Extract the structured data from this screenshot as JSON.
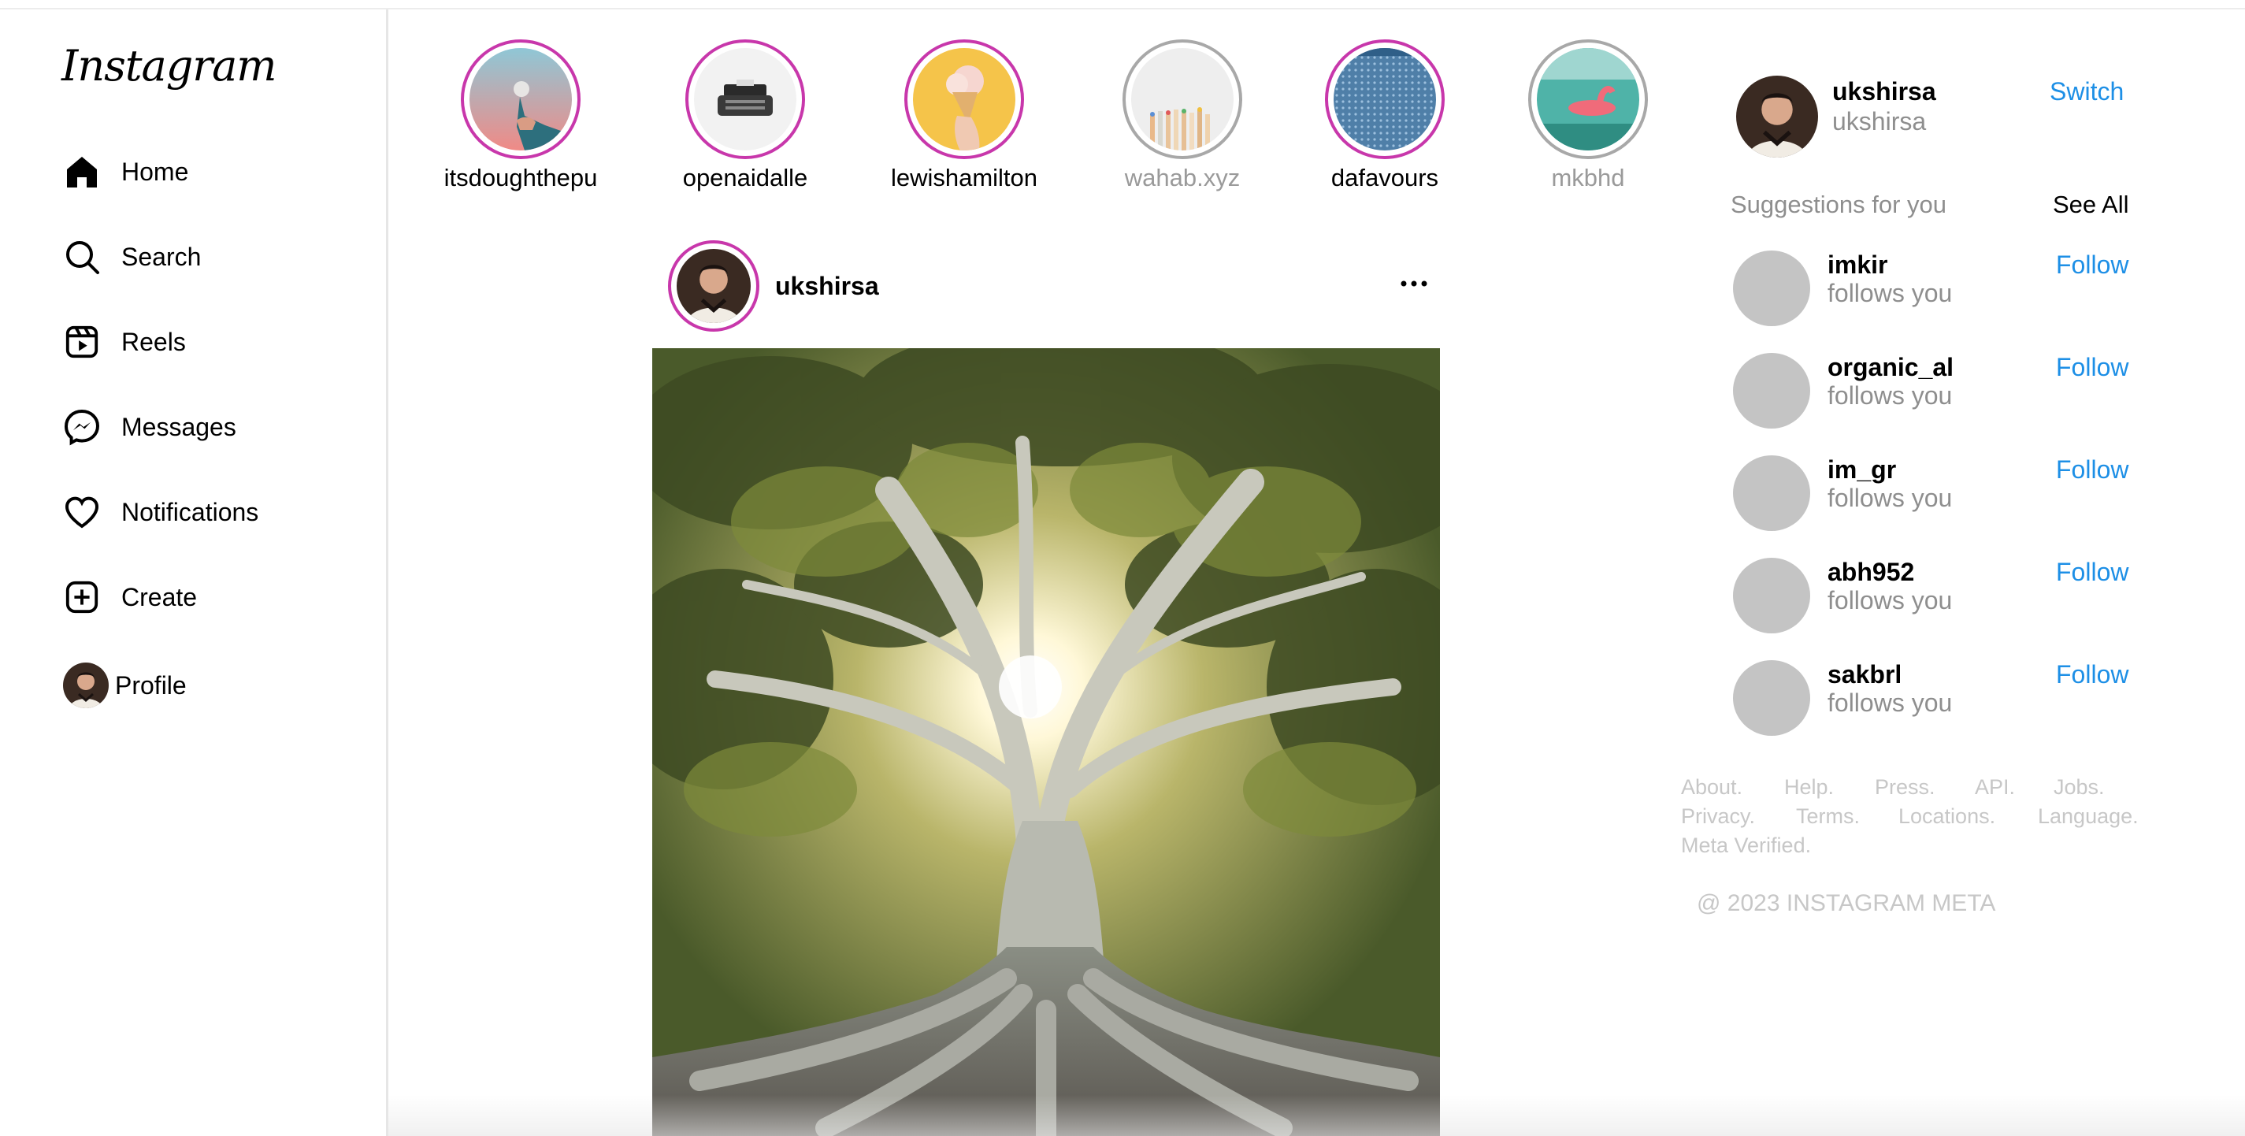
{
  "app": {
    "logo_text": "Instagram"
  },
  "sidebar": {
    "items": [
      {
        "label": "Home",
        "icon": "home-icon"
      },
      {
        "label": "Search",
        "icon": "search-icon"
      },
      {
        "label": "Reels",
        "icon": "reels-icon"
      },
      {
        "label": "Messages",
        "icon": "messenger-icon"
      },
      {
        "label": "Notifications",
        "icon": "heart-icon"
      },
      {
        "label": "Create",
        "icon": "plus-square-icon"
      },
      {
        "label": "Profile",
        "icon": "avatar"
      }
    ]
  },
  "stories": [
    {
      "username": "itsdoughthepu",
      "seen": false
    },
    {
      "username": "openaidalle",
      "seen": false
    },
    {
      "username": "lewishamilton",
      "seen": false
    },
    {
      "username": "wahab.xyz",
      "seen": true
    },
    {
      "username": "dafavours",
      "seen": false
    },
    {
      "username": "mkbhd",
      "seen": true
    }
  ],
  "post": {
    "username": "ukshirsa",
    "more_icon": "more-horizontal-icon"
  },
  "current_user": {
    "username": "ukshirsa",
    "full_name": "ukshirsa",
    "switch_label": "Switch"
  },
  "suggestions": {
    "title": "Suggestions for you",
    "see_all_label": "See All",
    "items": [
      {
        "username": "imkir",
        "subtitle": "follows you",
        "action": "Follow"
      },
      {
        "username": "organic_al",
        "subtitle": "follows you",
        "action": "Follow"
      },
      {
        "username": "im_gr",
        "subtitle": "follows you",
        "action": "Follow"
      },
      {
        "username": "abh952",
        "subtitle": "follows you",
        "action": "Follow"
      },
      {
        "username": "sakbrl",
        "subtitle": "follows you",
        "action": "Follow"
      }
    ]
  },
  "footer": {
    "links": [
      "About.",
      "Help.",
      "Press.",
      "API.",
      "Jobs.",
      "Privacy.",
      "Terms.",
      "Locations.",
      "Language.",
      "Meta Verified."
    ],
    "copyright": "@ 2023 INSTAGRAM META"
  },
  "colors": {
    "story_ring": "#c837ab",
    "seen_ring": "#a8a8a8",
    "link_blue": "#1d8fe6",
    "muted": "#8e8e8e"
  }
}
